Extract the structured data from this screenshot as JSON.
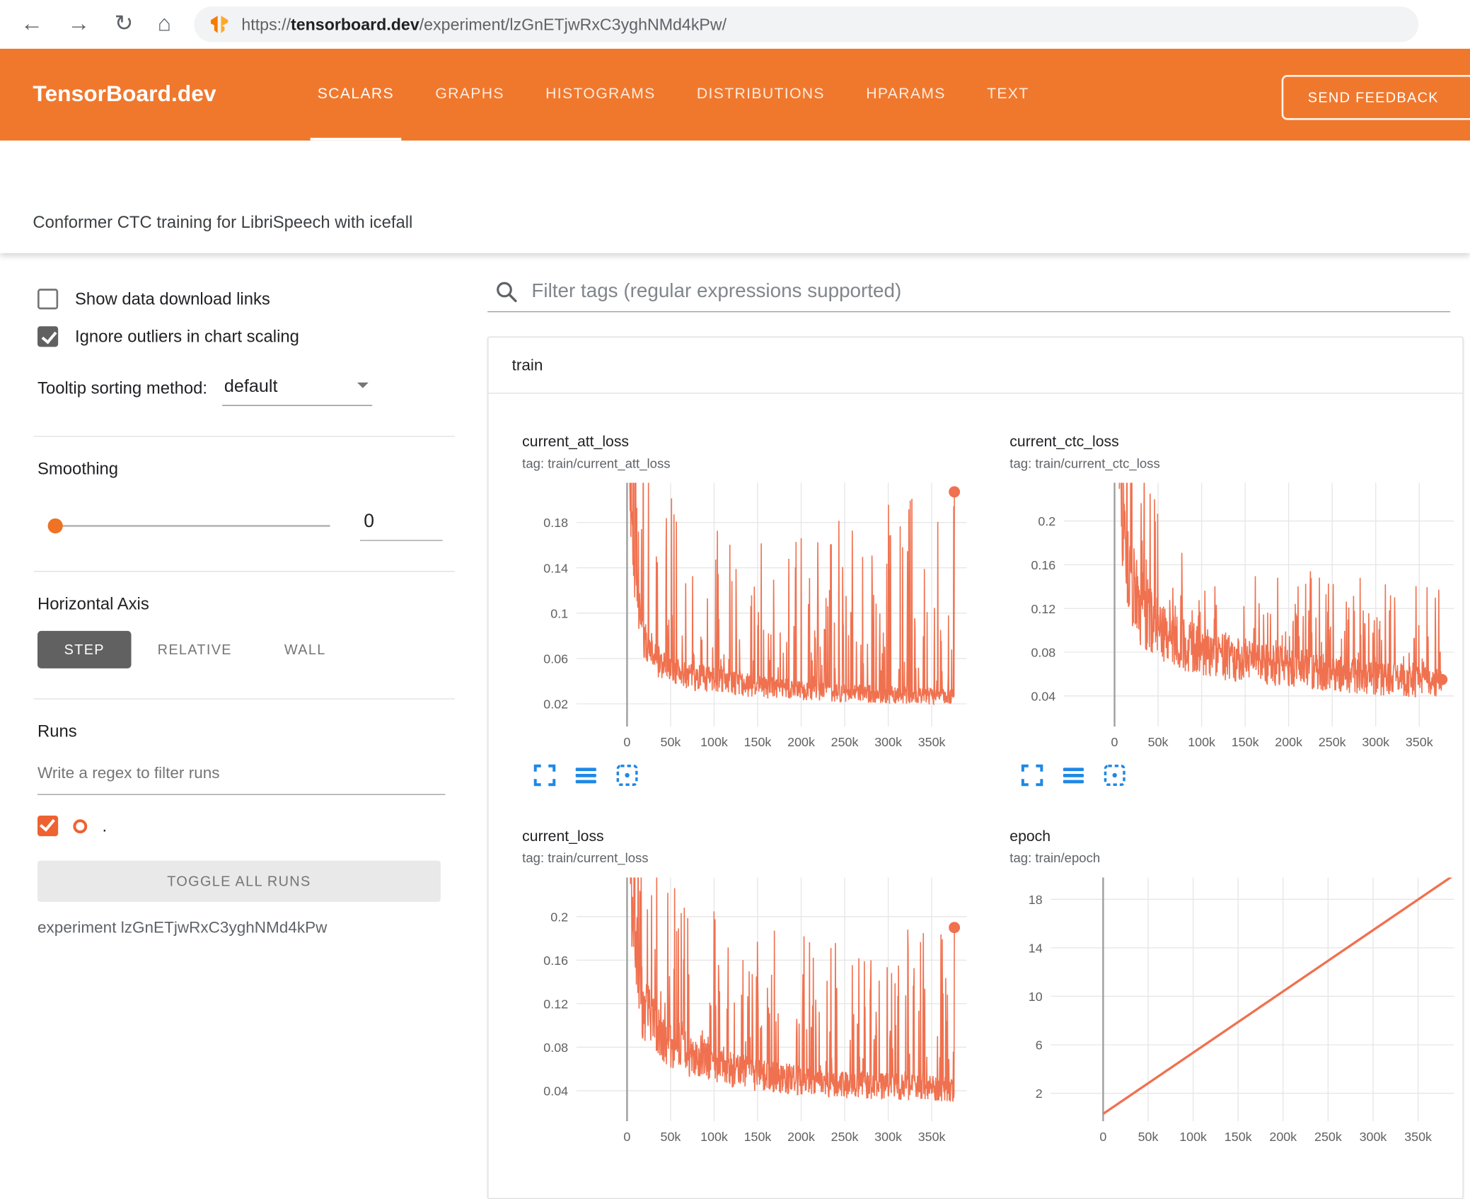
{
  "browser": {
    "url": "https://tensorboard.dev/experiment/lzGnETjwRxC3yghNMd4kPw/",
    "url_scheme": "https://",
    "url_host": "tensorboard.dev",
    "url_path": "/experiment/lzGnETjwRxC3yghNMd4kPw/"
  },
  "header": {
    "logo": "TensorBoard.dev",
    "tabs": [
      {
        "label": "SCALARS",
        "active": true
      },
      {
        "label": "GRAPHS",
        "active": false
      },
      {
        "label": "HISTOGRAMS",
        "active": false
      },
      {
        "label": "DISTRIBUTIONS",
        "active": false
      },
      {
        "label": "HPARAMS",
        "active": false
      },
      {
        "label": "TEXT",
        "active": false
      }
    ],
    "feedback_button": "SEND FEEDBACK"
  },
  "experiment": {
    "title": "Conformer CTC training for LibriSpeech with icefall",
    "id_label": "experiment lzGnETjwRxC3yghNMd4kPw"
  },
  "sidebar": {
    "show_download_label": "Show data download links",
    "show_download_checked": false,
    "ignore_outliers_label": "Ignore outliers in chart scaling",
    "ignore_outliers_checked": true,
    "tooltip_label": "Tooltip sorting method:",
    "tooltip_value": "default",
    "smoothing_label": "Smoothing",
    "smoothing_value": "0",
    "horizontal_axis_label": "Horizontal Axis",
    "axis_options": [
      {
        "label": "STEP",
        "active": true
      },
      {
        "label": "RELATIVE",
        "active": false
      },
      {
        "label": "WALL",
        "active": false
      }
    ],
    "runs_label": "Runs",
    "runs_filter_placeholder": "Write a regex to filter runs",
    "run_name": ".",
    "run_checked": true,
    "toggle_all_label": "TOGGLE ALL RUNS"
  },
  "main": {
    "filter_placeholder": "Filter tags (regular expressions supported)",
    "group_title": "train"
  },
  "colors": {
    "header_orange": "#f0782d",
    "run_orange": "#f0714f",
    "run_checkbox_orange": "#ee6231",
    "icon_blue": "#1e88e5",
    "grid_gray": "#e6e6e6",
    "zero_line_gray": "#9e9e9e",
    "tick_label_gray": "#616161"
  },
  "chart_data": [
    {
      "type": "line",
      "title": "current_att_loss",
      "tag": "tag: train/current_att_loss",
      "xlabel": "step",
      "legend_position": "none",
      "grid": true,
      "margin_left": 58,
      "xlim": [
        -58000,
        390000
      ],
      "ylim": [
        0,
        0.215
      ],
      "xticks": [
        0,
        50000,
        100000,
        150000,
        200000,
        250000,
        300000,
        350000
      ],
      "xtick_labels": [
        "0",
        "50k",
        "100k",
        "150k",
        "200k",
        "250k",
        "300k",
        "350k"
      ],
      "yticks": [
        0.02,
        0.06,
        0.1,
        0.14,
        0.18
      ],
      "ytick_labels": [
        "0.02",
        "0.06",
        "0.1",
        "0.14",
        "0.18"
      ],
      "series": {
        "name": ".",
        "kind": "noisy",
        "seed": 7,
        "points_n": 950,
        "xrange": [
          0,
          376000
        ],
        "baseline": [
          [
            0,
            0.45
          ],
          [
            4000,
            0.2
          ],
          [
            10000,
            0.11
          ],
          [
            20000,
            0.075
          ],
          [
            40000,
            0.055
          ],
          [
            80000,
            0.045
          ],
          [
            150000,
            0.036
          ],
          [
            250000,
            0.03
          ],
          [
            376000,
            0.027
          ]
        ],
        "spike_max": [
          [
            0,
            0.6
          ],
          [
            15000,
            0.3
          ],
          [
            40000,
            0.21
          ],
          [
            100000,
            0.18
          ],
          [
            200000,
            0.17
          ],
          [
            300000,
            0.2
          ],
          [
            376000,
            0.21
          ]
        ],
        "spike_prob": 0.2,
        "end_value": 0.207,
        "end_marker": true,
        "stroke_width": 1.2
      }
    },
    {
      "type": "line",
      "title": "current_ctc_loss",
      "tag": "tag: train/current_ctc_loss",
      "xlabel": "step",
      "legend_position": "none",
      "grid": true,
      "margin_left": 58,
      "xlim": [
        -58000,
        390000
      ],
      "ylim": [
        0.012,
        0.235
      ],
      "xticks": [
        0,
        50000,
        100000,
        150000,
        200000,
        250000,
        300000,
        350000
      ],
      "xtick_labels": [
        "0",
        "50k",
        "100k",
        "150k",
        "200k",
        "250k",
        "300k",
        "350k"
      ],
      "yticks": [
        0.04,
        0.08,
        0.12,
        0.16,
        0.2
      ],
      "ytick_labels": [
        "0.04",
        "0.08",
        "0.12",
        "0.16",
        "0.2"
      ],
      "series": {
        "name": ".",
        "kind": "noisy",
        "seed": 13,
        "points_n": 950,
        "xrange": [
          0,
          376000
        ],
        "baseline": [
          [
            0,
            0.5
          ],
          [
            5000,
            0.26
          ],
          [
            15000,
            0.16
          ],
          [
            30000,
            0.12
          ],
          [
            60000,
            0.095
          ],
          [
            120000,
            0.078
          ],
          [
            250000,
            0.062
          ],
          [
            376000,
            0.053
          ]
        ],
        "spike_max": [
          [
            0,
            0.7
          ],
          [
            20000,
            0.3
          ],
          [
            60000,
            0.19
          ],
          [
            150000,
            0.15
          ],
          [
            250000,
            0.165
          ],
          [
            376000,
            0.14
          ]
        ],
        "spike_prob": 0.22,
        "end_value": 0.055,
        "end_marker": true,
        "stroke_width": 1.2
      }
    },
    {
      "type": "line",
      "title": "current_loss",
      "tag": "tag: train/current_loss",
      "xlabel": "step",
      "legend_position": "none",
      "grid": true,
      "margin_left": 58,
      "xlim": [
        -58000,
        390000
      ],
      "ylim": [
        0.012,
        0.236
      ],
      "xticks": [
        0,
        50000,
        100000,
        150000,
        200000,
        250000,
        300000,
        350000
      ],
      "xtick_labels": [
        "0",
        "50k",
        "100k",
        "150k",
        "200k",
        "250k",
        "300k",
        "350k"
      ],
      "yticks": [
        0.04,
        0.08,
        0.12,
        0.16,
        0.2
      ],
      "ytick_labels": [
        "0.04",
        "0.08",
        "0.12",
        "0.16",
        "0.2"
      ],
      "series": {
        "name": ".",
        "kind": "noisy",
        "seed": 21,
        "points_n": 950,
        "xrange": [
          0,
          376000
        ],
        "baseline": [
          [
            0,
            0.5
          ],
          [
            5000,
            0.22
          ],
          [
            15000,
            0.13
          ],
          [
            40000,
            0.09
          ],
          [
            80000,
            0.07
          ],
          [
            150000,
            0.055
          ],
          [
            250000,
            0.047
          ],
          [
            376000,
            0.042
          ]
        ],
        "spike_max": [
          [
            0,
            0.7
          ],
          [
            20000,
            0.28
          ],
          [
            60000,
            0.22
          ],
          [
            150000,
            0.19
          ],
          [
            250000,
            0.19
          ],
          [
            376000,
            0.2
          ]
        ],
        "spike_prob": 0.2,
        "end_value": 0.19,
        "end_marker": true,
        "stroke_width": 1.2
      }
    },
    {
      "type": "line",
      "title": "epoch",
      "tag": "tag: train/epoch",
      "xlabel": "step",
      "legend_position": "none",
      "grid": true,
      "margin_left": 44,
      "xlim": [
        -58000,
        390000
      ],
      "ylim": [
        -0.3,
        19.8
      ],
      "xticks": [
        0,
        50000,
        100000,
        150000,
        200000,
        250000,
        300000,
        350000
      ],
      "xtick_labels": [
        "0",
        "50k",
        "100k",
        "150k",
        "200k",
        "250k",
        "300k",
        "350k"
      ],
      "yticks": [
        2,
        6,
        10,
        14,
        18
      ],
      "ytick_labels": [
        "2",
        "6",
        "10",
        "14",
        "18"
      ],
      "series": {
        "name": ".",
        "kind": "linear",
        "points": [
          [
            0,
            0.3
          ],
          [
            388000,
            19.9
          ]
        ],
        "end_marker": false,
        "stroke_width": 2.5
      }
    }
  ]
}
